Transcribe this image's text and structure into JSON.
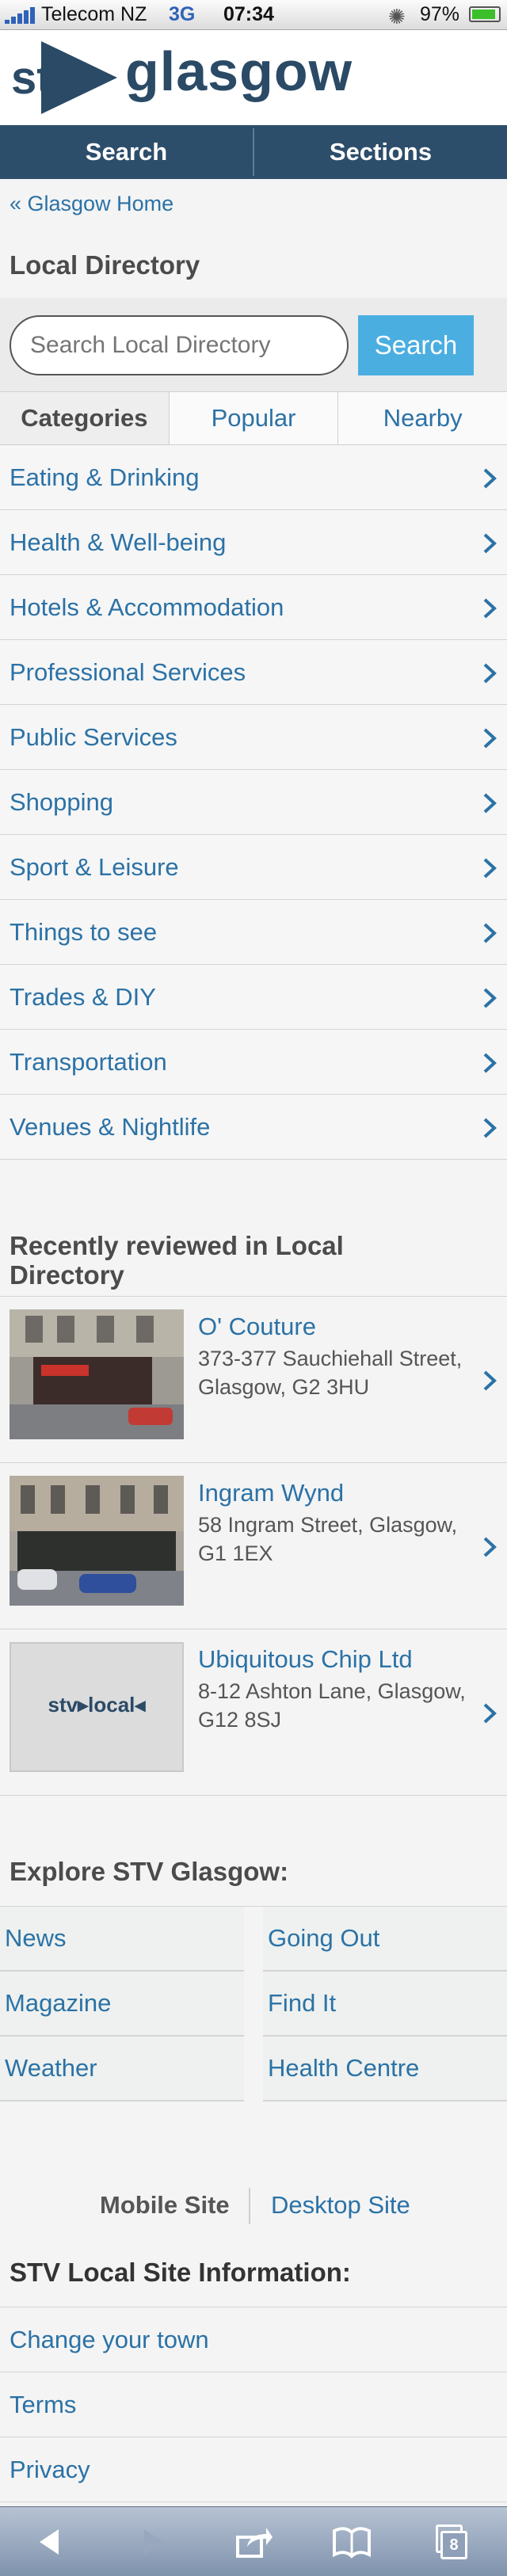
{
  "status_bar": {
    "carrier": "Telecom NZ",
    "network": "3G",
    "time": "07:34",
    "battery": "97%"
  },
  "header": {
    "logo_text": "stv",
    "brand": "glasgow"
  },
  "nav": {
    "search_label": "Search",
    "sections_label": "Sections"
  },
  "breadcrumb": "« Glasgow Home",
  "page_title": "Local Directory",
  "search": {
    "placeholder": "Search Local Directory",
    "button_label": "Search"
  },
  "tabs": [
    {
      "label": "Categories"
    },
    {
      "label": "Popular"
    },
    {
      "label": "Nearby"
    }
  ],
  "categories": [
    {
      "label": "Eating & Drinking"
    },
    {
      "label": "Health & Well-being"
    },
    {
      "label": "Hotels & Accommodation"
    },
    {
      "label": "Professional Services"
    },
    {
      "label": "Public Services"
    },
    {
      "label": "Shopping"
    },
    {
      "label": "Sport & Leisure"
    },
    {
      "label": "Things to see"
    },
    {
      "label": "Trades & DIY"
    },
    {
      "label": "Transportation"
    },
    {
      "label": "Venues & Nightlife"
    }
  ],
  "recent": {
    "title": "Recently reviewed in Local Directory",
    "items": [
      {
        "name": "O' Couture",
        "address": "373-377 Sauchiehall Street, Glasgow, G2 3HU"
      },
      {
        "name": "Ingram Wynd",
        "address": "58 Ingram Street, Glasgow, G1 1EX"
      },
      {
        "name": "Ubiquitous Chip Ltd",
        "address": "8-12 Ashton Lane, Glasgow, G12 8SJ",
        "thumb_text": "stv▸local◂"
      }
    ]
  },
  "explore": {
    "title": "Explore STV Glasgow:",
    "links": [
      {
        "label": "News"
      },
      {
        "label": "Going Out"
      },
      {
        "label": "Magazine"
      },
      {
        "label": "Find It"
      },
      {
        "label": "Weather"
      },
      {
        "label": "Health Centre"
      }
    ]
  },
  "footer": {
    "mobile_site": "Mobile Site",
    "desktop_site": "Desktop Site",
    "info_title": "STV Local Site Information:",
    "info_links": [
      {
        "label": "Change your town"
      },
      {
        "label": "Terms"
      },
      {
        "label": "Privacy"
      }
    ]
  },
  "browser_toolbar": {
    "tab_count": "8"
  },
  "colors": {
    "nav_bg": "#2d4e6b",
    "link": "#2b72a6",
    "search_button": "#4aaee0"
  }
}
